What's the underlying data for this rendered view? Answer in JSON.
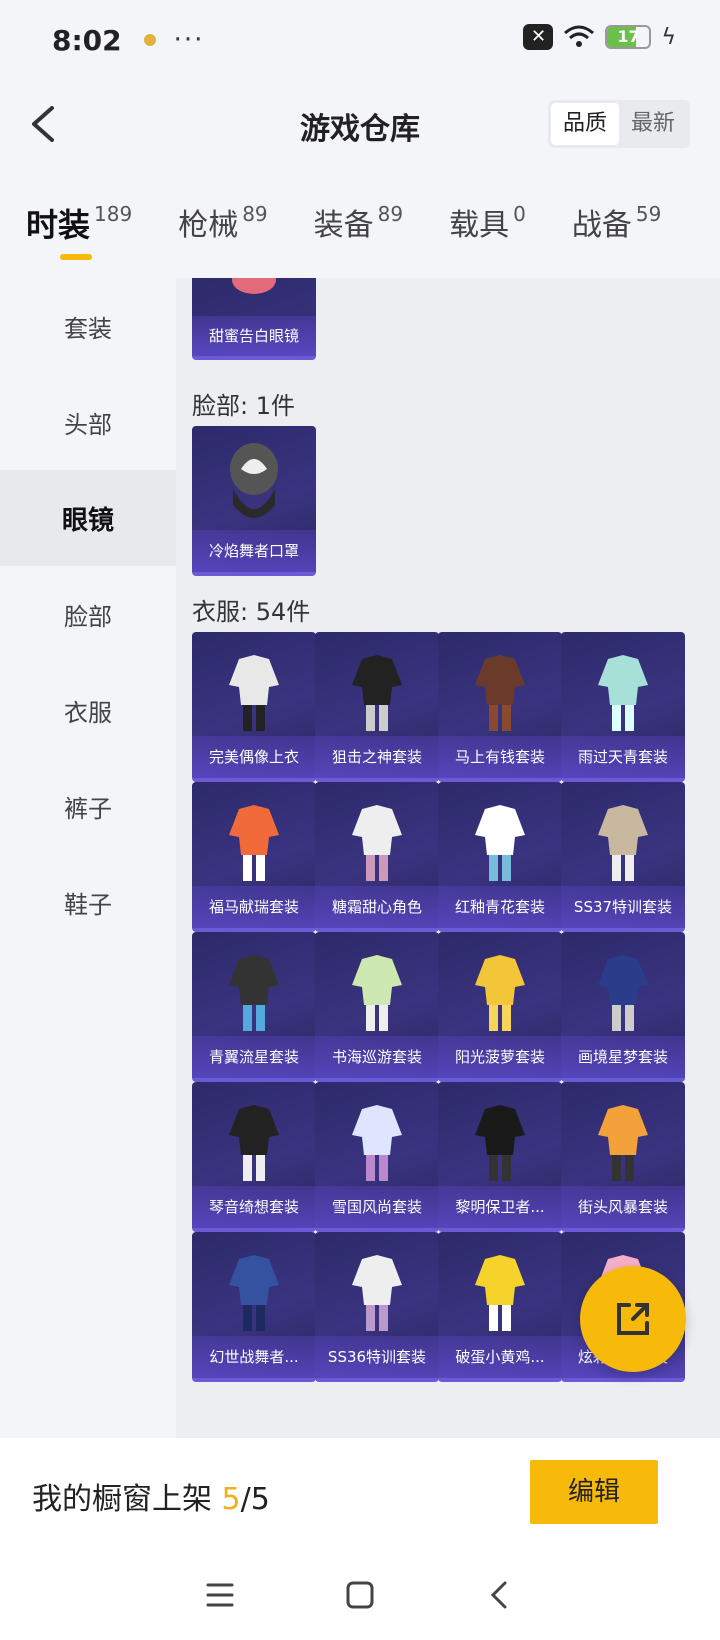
{
  "status": {
    "time": "8:02",
    "more": "···",
    "battery": "17",
    "battery_level": 0.17
  },
  "header": {
    "title": "游戏仓库",
    "sort_options": [
      "品质",
      "最新"
    ],
    "active_sort": 0
  },
  "tabs": [
    {
      "label": "时装",
      "count": "189"
    },
    {
      "label": "枪械",
      "count": "89"
    },
    {
      "label": "装备",
      "count": "89"
    },
    {
      "label": "载具",
      "count": "0"
    },
    {
      "label": "战备",
      "count": "59"
    }
  ],
  "sidebar": [
    "套装",
    "头部",
    "眼镜",
    "脸部",
    "衣服",
    "裤子",
    "鞋子"
  ],
  "sections": {
    "glasses_item": "甜蜜告白眼镜",
    "face_title": "脸部: 1件",
    "face_item": "冷焰舞者口罩",
    "clothes_title": "衣服: 54件",
    "clothes": [
      "完美偶像上衣",
      "狙击之神套装",
      "马上有钱套装",
      "雨过天青套装",
      "福马献瑞套装",
      "糖霜甜心角色",
      "红釉青花套装",
      "SS37特训套装",
      "青翼流星套装",
      "书海巡游套装",
      "阳光菠萝套装",
      "画境星梦套装",
      "琴音绮想套装",
      "雪国风尚套装",
      "黎明保卫者...",
      "街头风暴套装",
      "幻世战舞者...",
      "SS36特训套装",
      "破蛋小黄鸡...",
      "炫彩糖果套装"
    ]
  },
  "bottom": {
    "shop_label": "我的橱窗上架 ",
    "shop_current": "5",
    "shop_total": "/5",
    "edit": "编辑"
  },
  "colors": {
    "accent": "#f7b90a",
    "card_bg": "#2d2a6a"
  }
}
